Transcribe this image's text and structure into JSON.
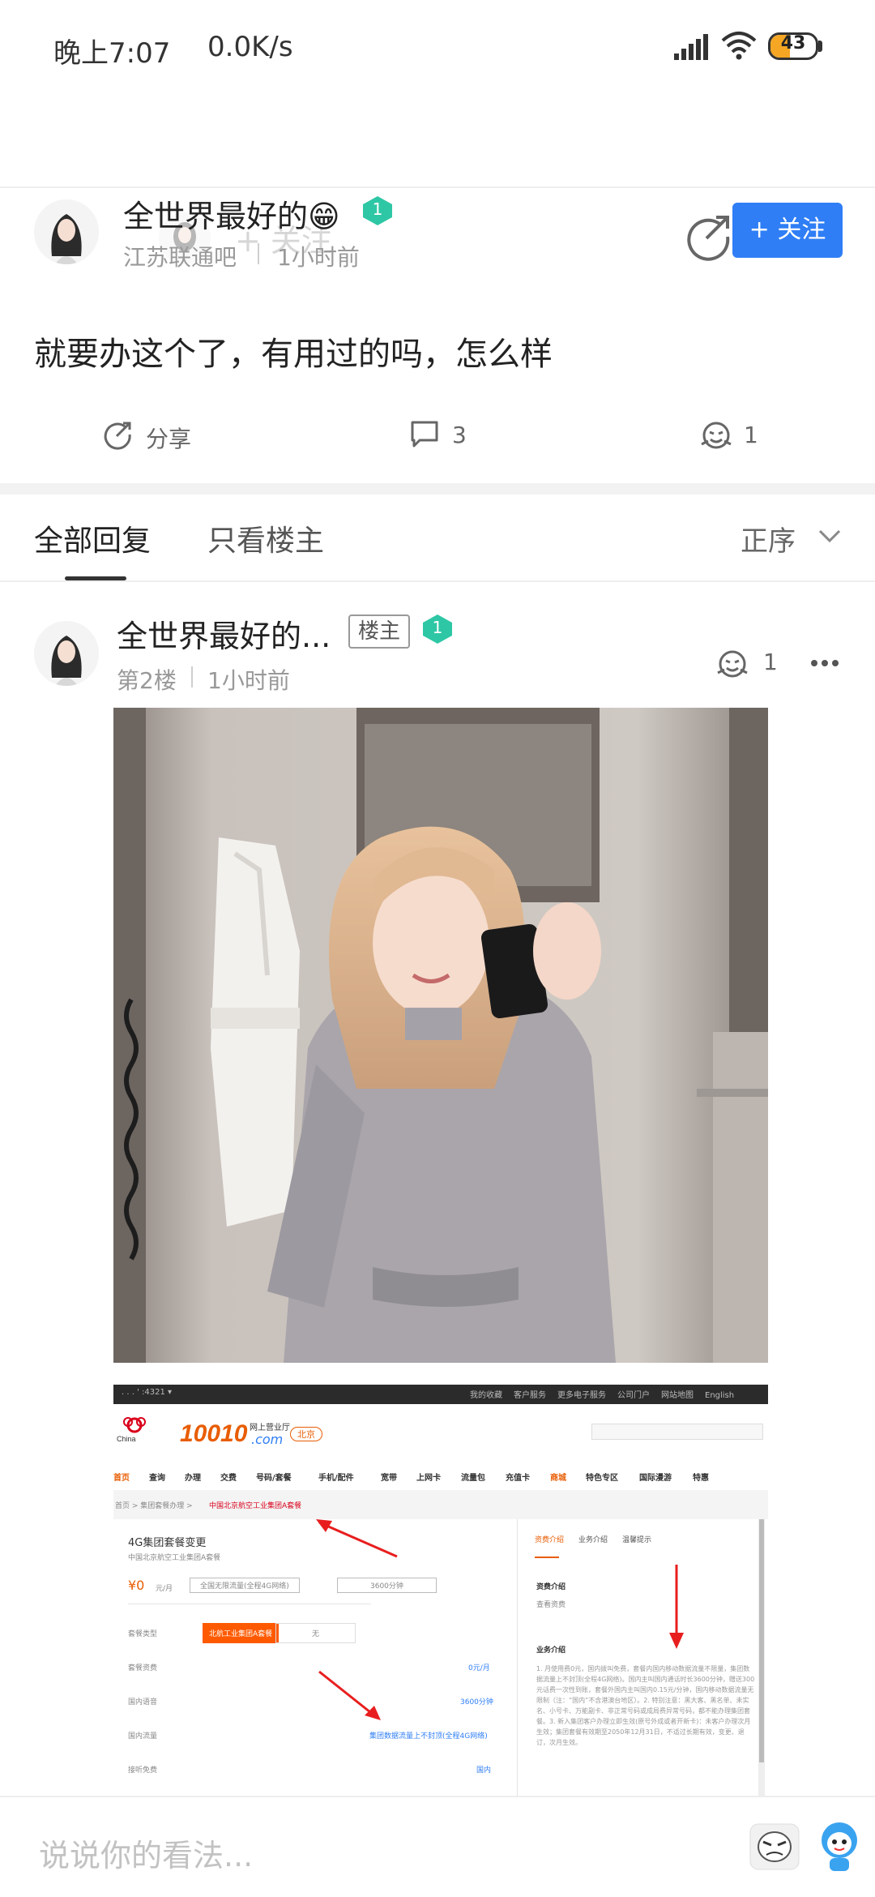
{
  "status_bar": {
    "time": "晚上7:07",
    "net_speed": "0.0K/s",
    "battery": "43",
    "battery_level": 0.43
  },
  "nav": {
    "follow_label": "+ 关注"
  },
  "post": {
    "author": "全世界最好的😁",
    "level": "1",
    "forum": "江苏联通吧",
    "time": "1小时前",
    "follow_button": "+ 关注",
    "body": "就要办这个了，有用过的吗，怎么样",
    "share_label": "分享",
    "comment_count": "3",
    "like_count": "1"
  },
  "tabs": {
    "all": "全部回复",
    "host_only": "只看楼主",
    "sort": "正序"
  },
  "reply": {
    "author": "全世界最好的...",
    "host_badge": "楼主",
    "level": "1",
    "floor": "第2楼",
    "time": "1小时前",
    "like_count": "1"
  },
  "screenshot": {
    "logo_text": "10010",
    "logo_suffix": ".com",
    "logo_sub": "网上营业厅",
    "region": "北京",
    "nav_items": [
      "首页",
      "查询",
      "办理",
      "交费",
      "号码/套餐",
      "手机/配件",
      "宽带",
      "上网卡",
      "流量包",
      "充值卡",
      "商城",
      "特色专区",
      "国际漫游",
      "特惠"
    ],
    "top_links": [
      "我的收藏",
      "客户服务",
      "更多电子服务",
      "公司门户",
      "网站地图",
      "English"
    ],
    "breadcrumb_current": "中国北京航空工业集团A套餐",
    "breadcrumb_prefix": "首页 > 集团套餐办理 >",
    "section_title": "4G集团套餐变更",
    "section_sub": "中国北京航空工业集团A套餐",
    "price": "¥0",
    "price_unit": "元/月",
    "box1": "全国无限流量(全程4G网络)",
    "box2": "3600分钟",
    "type_label": "套餐类型",
    "type_selected": "北航工业集团A套餐",
    "type_other": "无",
    "fee_label": "套餐资费",
    "fee_value": "0元/月",
    "voice_label": "国内语音",
    "voice_value": "3600分钟",
    "data_label": "国内流量",
    "data_value": "集团数据流量上不封顶(全程4G网络)",
    "listen_label": "接听免费",
    "listen_value": "国内",
    "right_tabs": [
      "资费介绍",
      "业务介绍",
      "温馨提示"
    ],
    "right_h1": "资费介绍",
    "right_link": "查看资费",
    "right_h2": "业务介绍",
    "right_body": "1. 月使用费0元，国内拨叫免费，套餐内国内移动数据流量不限量，集团数据流量上不封顶(全程4G网络)。国内主叫国内通话时长3600分钟，赠送300元话费一次性到账，套餐外国内主叫国内0.15元/分钟，国内移动数据流量无限制（注：“国内”不含港澳台地区）。2. 特别注意：黑大客、黑名单、未实名、小号卡、万能副卡、非正常号码或成局费异常号码，都不能办理集团套餐。3. 新入集团客户办理立即生效(原号外成或者开新卡)：未客户办理次月生效；集团套餐有效期至2050年12月31日，不适过长期有效，变更、退订，次月生效。"
  },
  "bottom": {
    "placeholder": "说说你的看法..."
  },
  "colors": {
    "accent": "#2f7ef5",
    "level_badge": "#2ec7a5",
    "unicom_orange": "#e85d04",
    "unicom_red": "#d9001b"
  }
}
